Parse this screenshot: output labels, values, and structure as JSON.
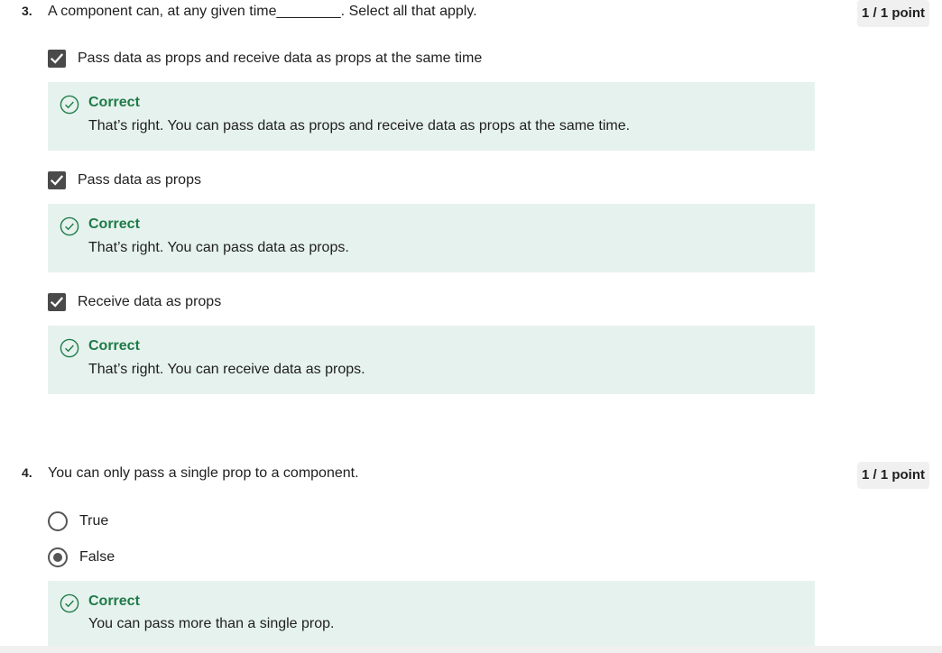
{
  "questions": [
    {
      "number": "3.",
      "text": "A component can, at any given time________. Select all that apply.",
      "points": "1 / 1 point",
      "options": [
        {
          "label": "Pass data as props and receive data as props at the same time",
          "checked": true,
          "feedback": {
            "title": "Correct",
            "text": "That’s right. You can pass data as props and receive data as props at the same time."
          }
        },
        {
          "label": "Pass data as props",
          "checked": true,
          "feedback": {
            "title": "Correct",
            "text": "That’s right. You can pass data as props."
          }
        },
        {
          "label": "Receive data as props",
          "checked": true,
          "feedback": {
            "title": "Correct",
            "text": "That’s right. You can receive data as props."
          }
        }
      ]
    },
    {
      "number": "4.",
      "text": "You can only pass a single prop to a component.",
      "points": "1 / 1 point",
      "options": [
        {
          "label": "True",
          "selected": false
        },
        {
          "label": "False",
          "selected": true
        }
      ],
      "feedback": {
        "title": "Correct",
        "text": "You can pass more than a single prop."
      }
    }
  ],
  "colors": {
    "feedback_bg": "#e6f2ee",
    "correct_green": "#1e7b48",
    "checkbox_fill": "#4a4a4a",
    "points_bg": "#f0f0f0"
  },
  "icons": {
    "checkbox": "checkmark-icon",
    "feedback": "check-circle-icon",
    "radio": "radio-dot-icon"
  }
}
